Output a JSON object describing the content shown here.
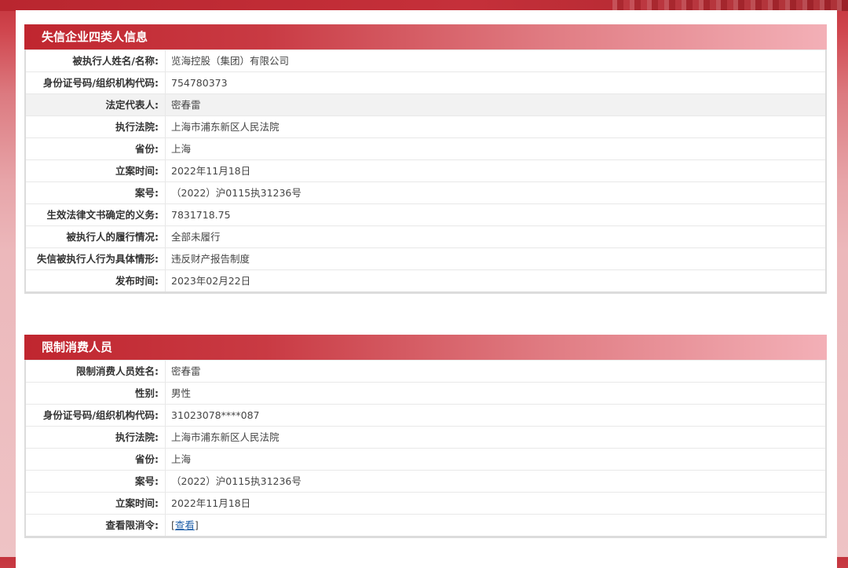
{
  "section1": {
    "title": "失信企业四类人信息",
    "rows": [
      {
        "label": "被执行人姓名/名称:",
        "value": "览海控股（集团）有限公司"
      },
      {
        "label": "身份证号码/组织机构代码:",
        "value": "754780373"
      },
      {
        "label": "法定代表人:",
        "value": "密春雷"
      },
      {
        "label": "执行法院:",
        "value": "上海市浦东新区人民法院"
      },
      {
        "label": "省份:",
        "value": "上海"
      },
      {
        "label": "立案时间:",
        "value": "2022年11月18日"
      },
      {
        "label": "案号:",
        "value": "（2022）沪0115执31236号"
      },
      {
        "label": "生效法律文书确定的义务:",
        "value": "7831718.75"
      },
      {
        "label": "被执行人的履行情况:",
        "value": "全部未履行"
      },
      {
        "label": "失信被执行人行为具体情形:",
        "value": "违反财产报告制度"
      },
      {
        "label": "发布时间:",
        "value": "2023年02月22日"
      }
    ]
  },
  "section2": {
    "title": "限制消费人员",
    "rows": [
      {
        "label": "限制消费人员姓名:",
        "value": "密春雷"
      },
      {
        "label": "性别:",
        "value": "男性"
      },
      {
        "label": "身份证号码/组织机构代码:",
        "value": "31023078****087"
      },
      {
        "label": "执行法院:",
        "value": "上海市浦东新区人民法院"
      },
      {
        "label": "省份:",
        "value": "上海"
      },
      {
        "label": "案号:",
        "value": "（2022）沪0115执31236号"
      },
      {
        "label": "立案时间:",
        "value": "2022年11月18日"
      },
      {
        "label": "查看限消令:",
        "value": "",
        "link_open": "[",
        "link_text": "查看",
        "link_close": "]"
      }
    ]
  }
}
